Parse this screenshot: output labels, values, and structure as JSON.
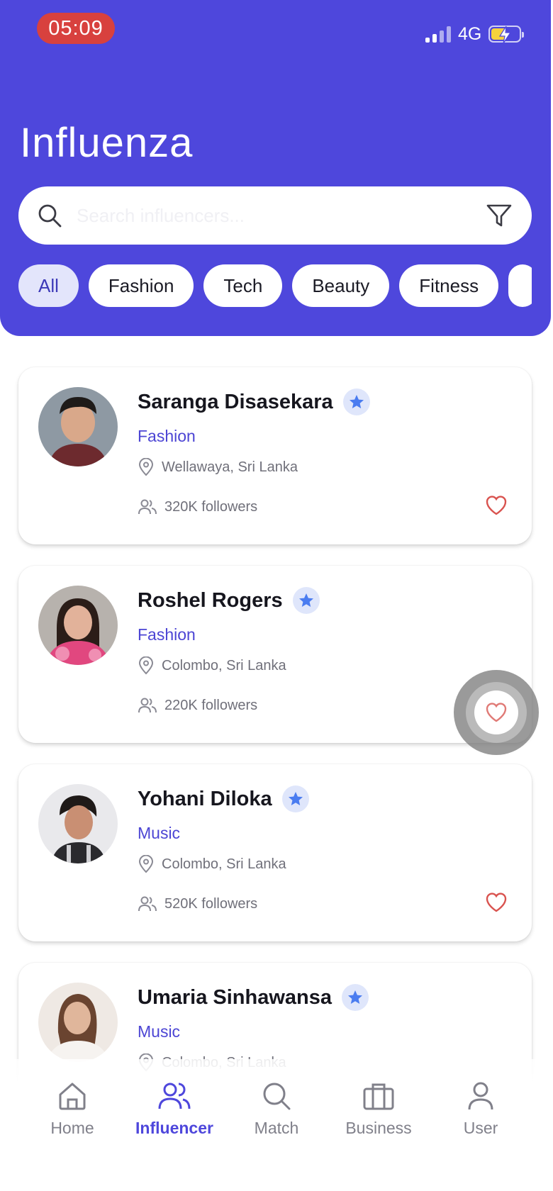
{
  "status": {
    "time": "05:09",
    "network": "4G"
  },
  "header": {
    "title": "Influenza"
  },
  "search": {
    "placeholder": "Search influencers..."
  },
  "filters": [
    "All",
    "Fashion",
    "Tech",
    "Beauty",
    "Fitness"
  ],
  "influencers": [
    {
      "name": "Saranga Disasekara",
      "category": "Fashion",
      "location": "Wellawaya, Sri Lanka",
      "followers": "320K followers"
    },
    {
      "name": "Roshel Rogers",
      "category": "Fashion",
      "location": "Colombo, Sri Lanka",
      "followers": "220K followers"
    },
    {
      "name": "Yohani Diloka",
      "category": "Music",
      "location": "Colombo, Sri Lanka",
      "followers": "520K followers"
    },
    {
      "name": "Umaria Sinhawansa",
      "category": "Music",
      "location": "Colombo, Sri Lanka",
      "followers": ""
    }
  ],
  "nav": [
    {
      "label": "Home",
      "icon": "home-icon"
    },
    {
      "label": "Influencer",
      "icon": "users-icon"
    },
    {
      "label": "Match",
      "icon": "search-icon"
    },
    {
      "label": "Business",
      "icon": "briefcase-icon"
    },
    {
      "label": "User",
      "icon": "user-icon"
    }
  ],
  "colors": {
    "primary": "#4e47dc",
    "accent_text": "#4c45d4",
    "heart": "#d9534f",
    "star": "#4a7cf0"
  }
}
